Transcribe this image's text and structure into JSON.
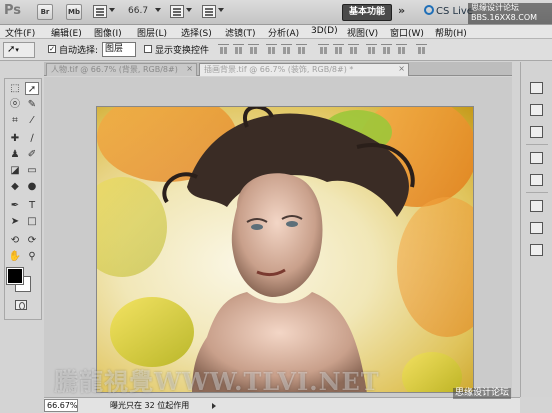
{
  "app": {
    "logo": "Ps",
    "bridge_label": "Br",
    "minibridge_label": "Mb",
    "zoom": "66.7",
    "workspace": "基本功能",
    "more": "»",
    "cslive": "CS Live",
    "watermark_top_line1": "思缘设计论坛",
    "watermark_top_line2": "BBS.16XX8.COM"
  },
  "menu": [
    "文件(F)",
    "编辑(E)",
    "图像(I)",
    "图层(L)",
    "选择(S)",
    "滤镜(T)",
    "分析(A)",
    "3D(D)",
    "视图(V)",
    "窗口(W)",
    "帮助(H)"
  ],
  "options": {
    "auto_select_label": "自动选择:",
    "auto_select_checked": true,
    "auto_select_value": "图层",
    "show_transform_label": "显示变换控件",
    "show_transform_checked": false
  },
  "documents": {
    "tabs": [
      {
        "label": "人物.tif @ 66.7% (背景, RGB/8#)",
        "close": "×",
        "active": false
      },
      {
        "label": "插画背景.tif @ 66.7% (装饰, RGB/8#) *",
        "close": "×",
        "active": true
      }
    ]
  },
  "tools": {
    "icons": [
      "move-tool-icon",
      "marquee-tool-icon",
      "lasso-tool-icon",
      "quick-select-tool-icon",
      "crop-tool-icon",
      "eyedropper-tool-icon",
      "healing-brush-tool-icon",
      "brush-tool-icon",
      "clone-stamp-tool-icon",
      "history-brush-tool-icon",
      "eraser-tool-icon",
      "gradient-tool-icon",
      "blur-tool-icon",
      "dodge-tool-icon",
      "pen-tool-icon",
      "type-tool-icon",
      "path-select-tool-icon",
      "shape-tool-icon",
      "3d-rotate-tool-icon",
      "3d-orbit-tool-icon",
      "hand-tool-icon",
      "zoom-tool-icon"
    ],
    "foreground": "#000000",
    "background": "#ffffff"
  },
  "status": {
    "zoom": "66.67%",
    "text": "曝光只在 32 位起作用"
  },
  "watermarks": {
    "big": "騰龍視覺WWW.TLVI.NET",
    "small": "思缘设计论坛"
  }
}
